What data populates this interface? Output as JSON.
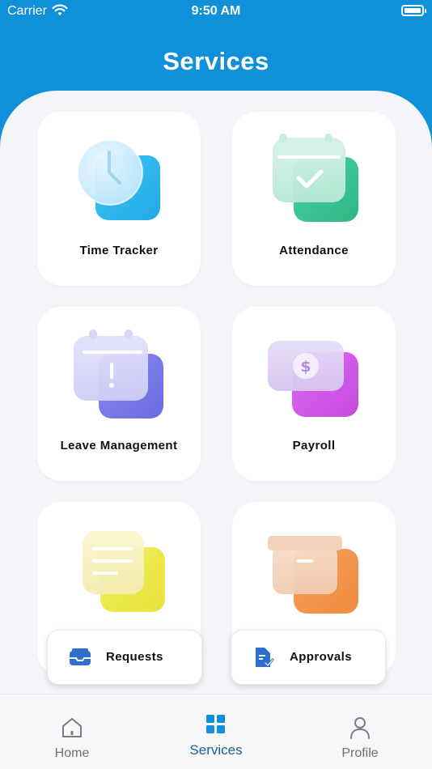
{
  "status_bar": {
    "carrier": "Carrier",
    "time": "9:50 AM"
  },
  "header": {
    "title": "Services"
  },
  "services": [
    {
      "label": "Time Tracker",
      "icon": "clock-icon"
    },
    {
      "label": "Attendance",
      "icon": "calendar-check-icon"
    },
    {
      "label": "Leave Management",
      "icon": "calendar-alert-icon"
    },
    {
      "label": "Payroll",
      "icon": "money-icon"
    },
    {
      "label": "",
      "icon": "document-icon"
    },
    {
      "label": "",
      "icon": "archive-box-icon"
    }
  ],
  "quick_actions": [
    {
      "label": "Requests",
      "icon": "inbox-icon"
    },
    {
      "label": "Approvals",
      "icon": "approval-document-icon"
    }
  ],
  "tabbar": {
    "items": [
      {
        "label": "Home",
        "icon": "home-icon"
      },
      {
        "label": "Services",
        "icon": "grid-icon",
        "active": true
      },
      {
        "label": "Profile",
        "icon": "person-icon"
      }
    ]
  },
  "colors": {
    "header": "#0f90d9",
    "sheet": "#f3f5f8",
    "active_tab": "#1f5f8d"
  }
}
